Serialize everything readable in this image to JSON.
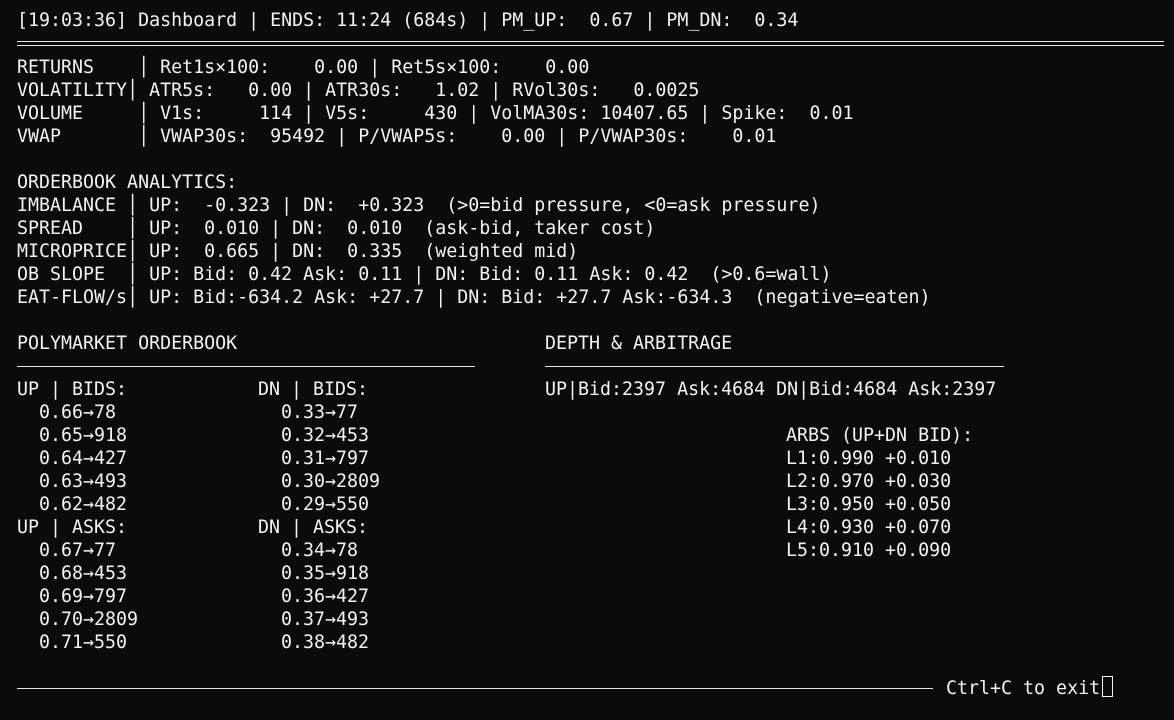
{
  "header": {
    "line": "[19:03:36] Dashboard | ENDS: 11:24 (684s) | PM_UP:  0.67 | PM_DN:  0.34"
  },
  "metrics": [
    "RETURNS    │ Ret1s×100:    0.00 | Ret5s×100:    0.00",
    "VOLATILITY│ ATR5s:   0.00 | ATR30s:   1.02 | RVol30s:   0.0025",
    "VOLUME     │ V1s:     114 | V5s:     430 | VolMA30s: 10407.65 | Spike:  0.01",
    "VWAP       │ VWAP30s:  95492 | P/VWAP5s:    0.00 | P/VWAP30s:    0.01"
  ],
  "orderbook_analytics": {
    "title": "ORDERBOOK ANALYTICS:",
    "rows": [
      "IMBALANCE │ UP:  -0.323 | DN:  +0.323  (>0=bid pressure, <0=ask pressure)",
      "SPREAD    │ UP:  0.010 | DN:  0.010  (ask-bid, taker cost)",
      "MICROPRICE│ UP:  0.665 | DN:  0.335  (weighted mid)",
      "OB SLOPE  │ UP: Bid: 0.42 Ask: 0.11 | DN: Bid: 0.11 Ask: 0.42  (>0.6=wall)",
      "EAT-FLOW/s│ UP: Bid:-634.2 Ask: +27.7 | DN: Bid: +27.7 Ask:-634.3  (negative=eaten)"
    ]
  },
  "polymarket": {
    "title": "POLYMARKET ORDERBOOK",
    "up_bids_header": "UP | BIDS:",
    "dn_bids_header": "DN | BIDS:",
    "up_bids": [
      "0.66→78",
      "0.65→918",
      "0.64→427",
      "0.63→493",
      "0.62→482"
    ],
    "dn_bids": [
      "0.33→77",
      "0.32→453",
      "0.31→797",
      "0.30→2809",
      "0.29→550"
    ],
    "up_asks_header": "UP | ASKS:",
    "dn_asks_header": "DN | ASKS:",
    "up_asks": [
      "0.67→77",
      "0.68→453",
      "0.69→797",
      "0.70→2809",
      "0.71→550"
    ],
    "dn_asks": [
      "0.34→78",
      "0.35→918",
      "0.36→427",
      "0.37→493",
      "0.38→482"
    ]
  },
  "depth": {
    "title": "DEPTH & ARBITRAGE",
    "line": "UP|Bid:2397 Ask:4684 DN|Bid:4684 Ask:2397",
    "arbs_title": "ARBS (UP+DN BID):",
    "arbs": [
      "L1:0.990 +0.010",
      "L2:0.970 +0.030",
      "L3:0.950 +0.050",
      "L4:0.930 +0.070",
      "L5:0.910 +0.090"
    ]
  },
  "footer": {
    "exit_hint": "Ctrl+C to exit"
  }
}
